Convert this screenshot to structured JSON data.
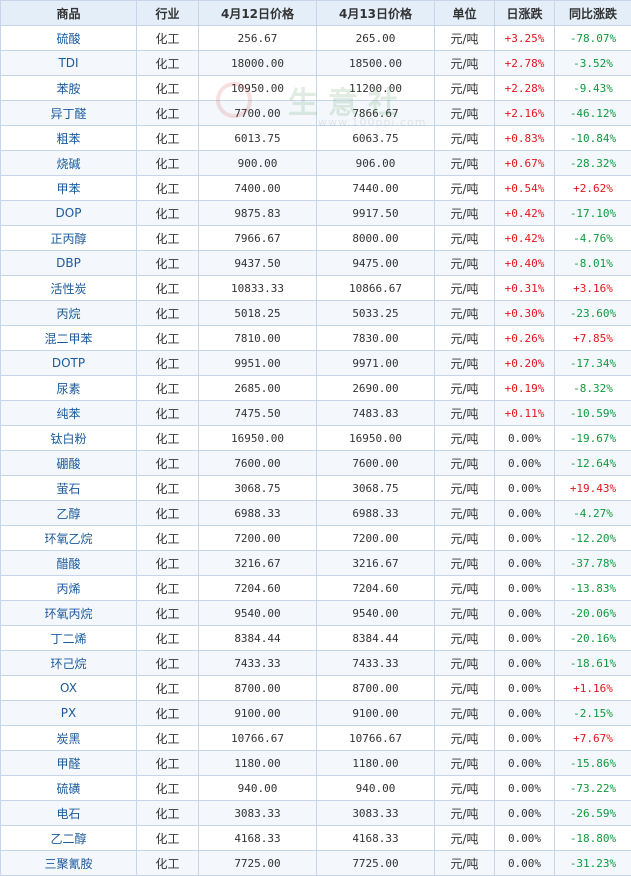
{
  "header": {
    "columns": [
      "商品",
      "行业",
      "4月12日价格",
      "4月13日价格",
      "单位",
      "日涨跌",
      "同比涨跌"
    ]
  },
  "watermark": {
    "brand": "生意社",
    "url": "www.100ppi.com"
  },
  "colors": {
    "up": "#e0161b",
    "down": "#0f9a3c",
    "name": "#1a5a9c",
    "header_bg": "#e3eef9",
    "border": "#c6d6e8"
  },
  "rows": [
    {
      "name": "硫酸",
      "industry": "化工",
      "price_prev": "256.67",
      "price_curr": "265.00",
      "unit": "元/吨",
      "daily": "+3.25%",
      "yoy": "-78.07%"
    },
    {
      "name": "TDI",
      "industry": "化工",
      "price_prev": "18000.00",
      "price_curr": "18500.00",
      "unit": "元/吨",
      "daily": "+2.78%",
      "yoy": "-3.52%"
    },
    {
      "name": "苯胺",
      "industry": "化工",
      "price_prev": "10950.00",
      "price_curr": "11200.00",
      "unit": "元/吨",
      "daily": "+2.28%",
      "yoy": "-9.43%"
    },
    {
      "name": "异丁醛",
      "industry": "化工",
      "price_prev": "7700.00",
      "price_curr": "7866.67",
      "unit": "元/吨",
      "daily": "+2.16%",
      "yoy": "-46.12%"
    },
    {
      "name": "粗苯",
      "industry": "化工",
      "price_prev": "6013.75",
      "price_curr": "6063.75",
      "unit": "元/吨",
      "daily": "+0.83%",
      "yoy": "-10.84%"
    },
    {
      "name": "烧碱",
      "industry": "化工",
      "price_prev": "900.00",
      "price_curr": "906.00",
      "unit": "元/吨",
      "daily": "+0.67%",
      "yoy": "-28.32%"
    },
    {
      "name": "甲苯",
      "industry": "化工",
      "price_prev": "7400.00",
      "price_curr": "7440.00",
      "unit": "元/吨",
      "daily": "+0.54%",
      "yoy": "+2.62%"
    },
    {
      "name": "DOP",
      "industry": "化工",
      "price_prev": "9875.83",
      "price_curr": "9917.50",
      "unit": "元/吨",
      "daily": "+0.42%",
      "yoy": "-17.10%"
    },
    {
      "name": "正丙醇",
      "industry": "化工",
      "price_prev": "7966.67",
      "price_curr": "8000.00",
      "unit": "元/吨",
      "daily": "+0.42%",
      "yoy": "-4.76%"
    },
    {
      "name": "DBP",
      "industry": "化工",
      "price_prev": "9437.50",
      "price_curr": "9475.00",
      "unit": "元/吨",
      "daily": "+0.40%",
      "yoy": "-8.01%"
    },
    {
      "name": "活性炭",
      "industry": "化工",
      "price_prev": "10833.33",
      "price_curr": "10866.67",
      "unit": "元/吨",
      "daily": "+0.31%",
      "yoy": "+3.16%"
    },
    {
      "name": "丙烷",
      "industry": "化工",
      "price_prev": "5018.25",
      "price_curr": "5033.25",
      "unit": "元/吨",
      "daily": "+0.30%",
      "yoy": "-23.60%"
    },
    {
      "name": "混二甲苯",
      "industry": "化工",
      "price_prev": "7810.00",
      "price_curr": "7830.00",
      "unit": "元/吨",
      "daily": "+0.26%",
      "yoy": "+7.85%"
    },
    {
      "name": "DOTP",
      "industry": "化工",
      "price_prev": "9951.00",
      "price_curr": "9971.00",
      "unit": "元/吨",
      "daily": "+0.20%",
      "yoy": "-17.34%"
    },
    {
      "name": "尿素",
      "industry": "化工",
      "price_prev": "2685.00",
      "price_curr": "2690.00",
      "unit": "元/吨",
      "daily": "+0.19%",
      "yoy": "-8.32%"
    },
    {
      "name": "纯苯",
      "industry": "化工",
      "price_prev": "7475.50",
      "price_curr": "7483.83",
      "unit": "元/吨",
      "daily": "+0.11%",
      "yoy": "-10.59%"
    },
    {
      "name": "钛白粉",
      "industry": "化工",
      "price_prev": "16950.00",
      "price_curr": "16950.00",
      "unit": "元/吨",
      "daily": "0.00%",
      "yoy": "-19.67%"
    },
    {
      "name": "硼酸",
      "industry": "化工",
      "price_prev": "7600.00",
      "price_curr": "7600.00",
      "unit": "元/吨",
      "daily": "0.00%",
      "yoy": "-12.64%"
    },
    {
      "name": "萤石",
      "industry": "化工",
      "price_prev": "3068.75",
      "price_curr": "3068.75",
      "unit": "元/吨",
      "daily": "0.00%",
      "yoy": "+19.43%"
    },
    {
      "name": "乙醇",
      "industry": "化工",
      "price_prev": "6988.33",
      "price_curr": "6988.33",
      "unit": "元/吨",
      "daily": "0.00%",
      "yoy": "-4.27%"
    },
    {
      "name": "环氧乙烷",
      "industry": "化工",
      "price_prev": "7200.00",
      "price_curr": "7200.00",
      "unit": "元/吨",
      "daily": "0.00%",
      "yoy": "-12.20%"
    },
    {
      "name": "醋酸",
      "industry": "化工",
      "price_prev": "3216.67",
      "price_curr": "3216.67",
      "unit": "元/吨",
      "daily": "0.00%",
      "yoy": "-37.78%"
    },
    {
      "name": "丙烯",
      "industry": "化工",
      "price_prev": "7204.60",
      "price_curr": "7204.60",
      "unit": "元/吨",
      "daily": "0.00%",
      "yoy": "-13.83%"
    },
    {
      "name": "环氧丙烷",
      "industry": "化工",
      "price_prev": "9540.00",
      "price_curr": "9540.00",
      "unit": "元/吨",
      "daily": "0.00%",
      "yoy": "-20.06%"
    },
    {
      "name": "丁二烯",
      "industry": "化工",
      "price_prev": "8384.44",
      "price_curr": "8384.44",
      "unit": "元/吨",
      "daily": "0.00%",
      "yoy": "-20.16%"
    },
    {
      "name": "环己烷",
      "industry": "化工",
      "price_prev": "7433.33",
      "price_curr": "7433.33",
      "unit": "元/吨",
      "daily": "0.00%",
      "yoy": "-18.61%"
    },
    {
      "name": "OX",
      "industry": "化工",
      "price_prev": "8700.00",
      "price_curr": "8700.00",
      "unit": "元/吨",
      "daily": "0.00%",
      "yoy": "+1.16%"
    },
    {
      "name": "PX",
      "industry": "化工",
      "price_prev": "9100.00",
      "price_curr": "9100.00",
      "unit": "元/吨",
      "daily": "0.00%",
      "yoy": "-2.15%"
    },
    {
      "name": "炭黑",
      "industry": "化工",
      "price_prev": "10766.67",
      "price_curr": "10766.67",
      "unit": "元/吨",
      "daily": "0.00%",
      "yoy": "+7.67%"
    },
    {
      "name": "甲醛",
      "industry": "化工",
      "price_prev": "1180.00",
      "price_curr": "1180.00",
      "unit": "元/吨",
      "daily": "0.00%",
      "yoy": "-15.86%"
    },
    {
      "name": "硫磺",
      "industry": "化工",
      "price_prev": "940.00",
      "price_curr": "940.00",
      "unit": "元/吨",
      "daily": "0.00%",
      "yoy": "-73.22%"
    },
    {
      "name": "电石",
      "industry": "化工",
      "price_prev": "3083.33",
      "price_curr": "3083.33",
      "unit": "元/吨",
      "daily": "0.00%",
      "yoy": "-26.59%"
    },
    {
      "name": "乙二醇",
      "industry": "化工",
      "price_prev": "4168.33",
      "price_curr": "4168.33",
      "unit": "元/吨",
      "daily": "0.00%",
      "yoy": "-18.80%"
    },
    {
      "name": "三聚氰胺",
      "industry": "化工",
      "price_prev": "7725.00",
      "price_curr": "7725.00",
      "unit": "元/吨",
      "daily": "0.00%",
      "yoy": "-31.23%"
    }
  ]
}
